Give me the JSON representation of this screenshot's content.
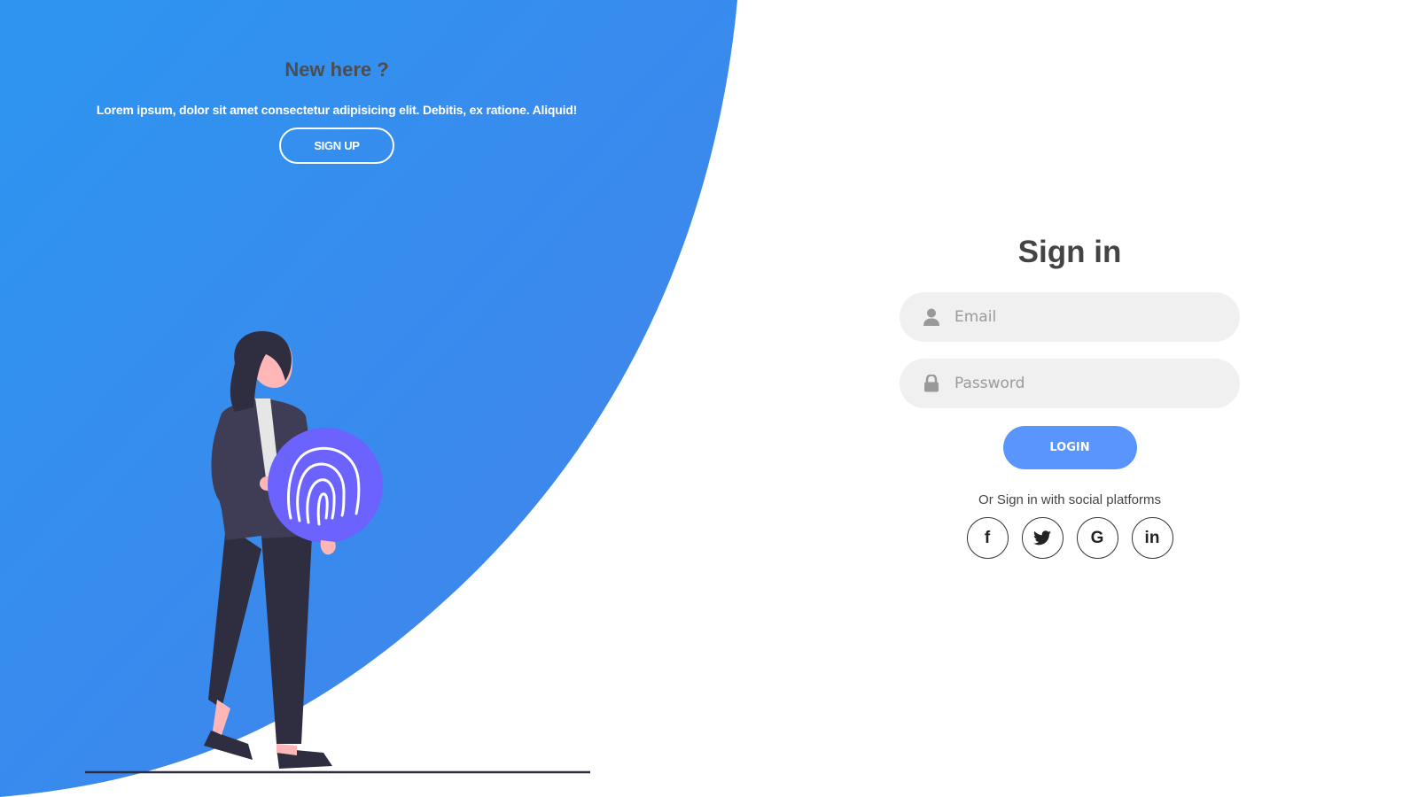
{
  "colors": {
    "gradient_start": "#2d95f0",
    "gradient_end": "#4481eb",
    "accent_button": "#5995fd",
    "fingerprint_circle": "#6c63ff",
    "figure_dark": "#2f2e41",
    "skin": "#ffb6b6"
  },
  "left_panel": {
    "title": "New here ?",
    "text": "Lorem ipsum, dolor sit amet consectetur adipisicing elit. Debitis, ex ratione. Aliquid!",
    "signup_label": "SIGN UP"
  },
  "signin": {
    "title": "Sign in",
    "email_placeholder": "Email",
    "email_icon": "user-icon",
    "password_placeholder": "Password",
    "password_icon": "lock-icon",
    "login_label": "LOGIN",
    "social_text": "Or Sign in with social platforms",
    "social": [
      {
        "icon": "facebook-icon",
        "glyph": "f"
      },
      {
        "icon": "twitter-icon",
        "glyph": ""
      },
      {
        "icon": "google-icon",
        "glyph": "G"
      },
      {
        "icon": "linkedin-icon",
        "glyph": "in"
      }
    ]
  }
}
